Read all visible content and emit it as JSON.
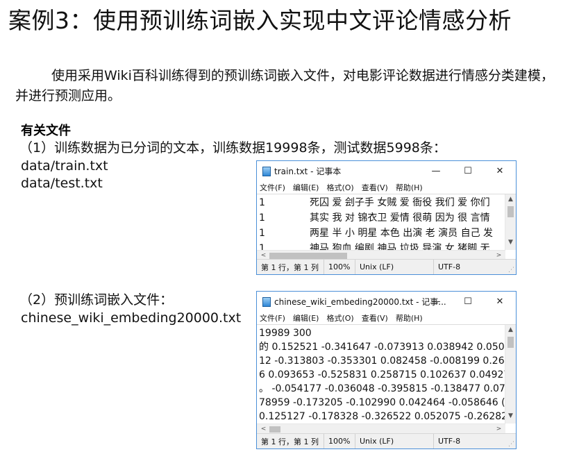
{
  "slide": {
    "title": "案例3：使用预训练词嵌入实现中文评论情感分析",
    "intro": "使用采用Wiki百科训练得到的预训练词嵌入文件，对电影评论数据进行情感分类建模，并进行预测应用。",
    "files_heading": "有关文件",
    "item1": "（1）训练数据为已分词的文本，训练数据19998条，测试数据5998条：",
    "train_path": "data/train.txt",
    "test_path": "data/test.txt",
    "item2": "（2）预训练词嵌入文件：",
    "embed_path": "chinese_wiki_embeding20000.txt"
  },
  "notepad1": {
    "title": "train.txt - 记事本",
    "menu": [
      "文件(F)",
      "编辑(E)",
      "格式(O)",
      "查看(V)",
      "帮助(H)"
    ],
    "lines": [
      {
        "label": "1",
        "text": "死囚 爱 刽子手 女贼 爱 衙役 我们 爱 你们"
      },
      {
        "label": "1",
        "text": "其实 我 对 锦衣卫 爱情 很萌 因为 很 言情"
      },
      {
        "label": "1",
        "text": "两星 半 小 明星 本色 出演 老 演员 自己 发"
      },
      {
        "label": "1",
        "text": "神马 狗血 编剧 神马 垃圾 导演 女 猪脚 无"
      }
    ],
    "status": {
      "position": "第 1 行，第 1 列",
      "zoom": "100%",
      "eol": "Unix (LF)",
      "encoding": "UTF-8"
    }
  },
  "notepad2": {
    "title": "chinese_wiki_embeding20000.txt - 记事...",
    "menu": [
      "文件(F)",
      "编辑(E)",
      "格式(O)",
      "查看(V)",
      "帮助(H)"
    ],
    "lines": [
      "19989 300",
      "的 0.152521 -0.341647 -0.073913 0.038942 0.050",
      "12 -0.313803 -0.353301 0.082458 -0.008199 0.26",
      "6 0.093653 -0.525831 0.258715 0.102637 0.04927",
      "。 -0.054177 -0.036048 -0.395815 -0.138477 0.07",
      "78959 -0.173205 -0.102990 0.042464 -0.058646 (",
      "0.125127 -0.178328 -0.326522 0.052075 -0.26282"
    ],
    "status": {
      "position": "第 1 行，第 1 列",
      "zoom": "100%",
      "eol": "Unix (LF)",
      "encoding": "UTF-8"
    }
  },
  "window_controls": {
    "minimize": "—",
    "maximize": "☐",
    "close": "✕"
  },
  "icons": {
    "scroll_up": "▲",
    "scroll_down": "▼",
    "scroll_left": "<",
    "scroll_right": ">",
    "grip": "⋰"
  }
}
